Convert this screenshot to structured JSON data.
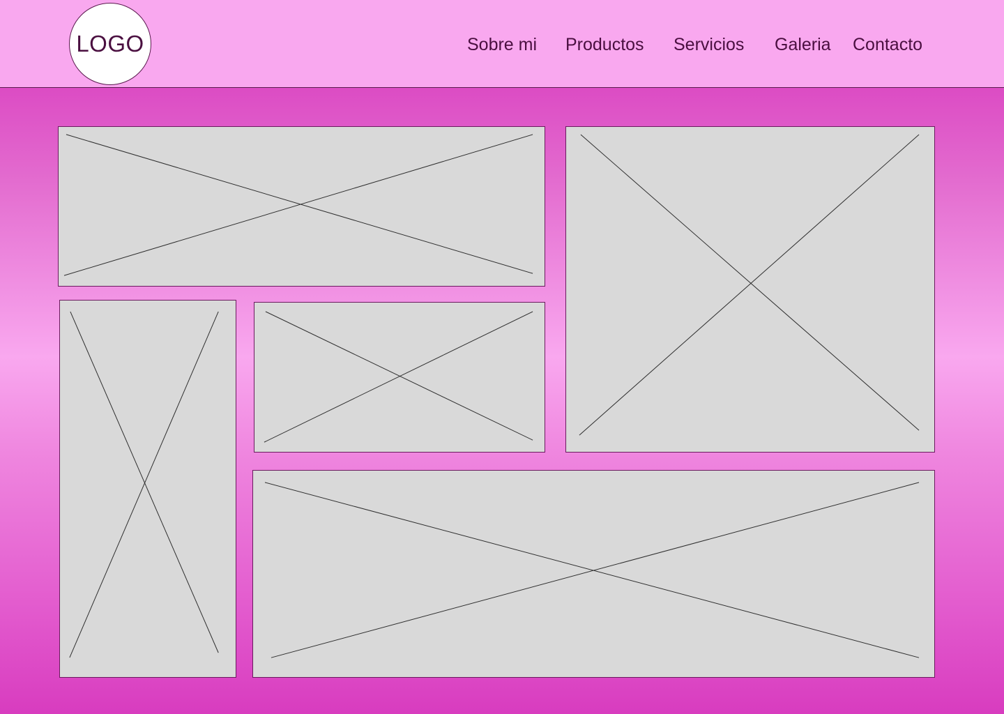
{
  "header": {
    "logo_label": "LOGO",
    "nav": [
      {
        "label": "Sobre mi"
      },
      {
        "label": "Productos"
      },
      {
        "label": "Servicios"
      },
      {
        "label": "Galeria"
      },
      {
        "label": "Contacto"
      }
    ]
  },
  "colors": {
    "header_background": "#f9a8ef",
    "page_gradient_edge": "#dc4cc4",
    "page_gradient_middle": "#f9a8ef",
    "text": "#4a0f40",
    "placeholder_fill": "#d9d9d9"
  },
  "gallery": {
    "placeholders": [
      {
        "icon": "image-placeholder-icon"
      },
      {
        "icon": "image-placeholder-icon"
      },
      {
        "icon": "image-placeholder-icon"
      },
      {
        "icon": "image-placeholder-icon"
      },
      {
        "icon": "image-placeholder-icon"
      }
    ]
  }
}
